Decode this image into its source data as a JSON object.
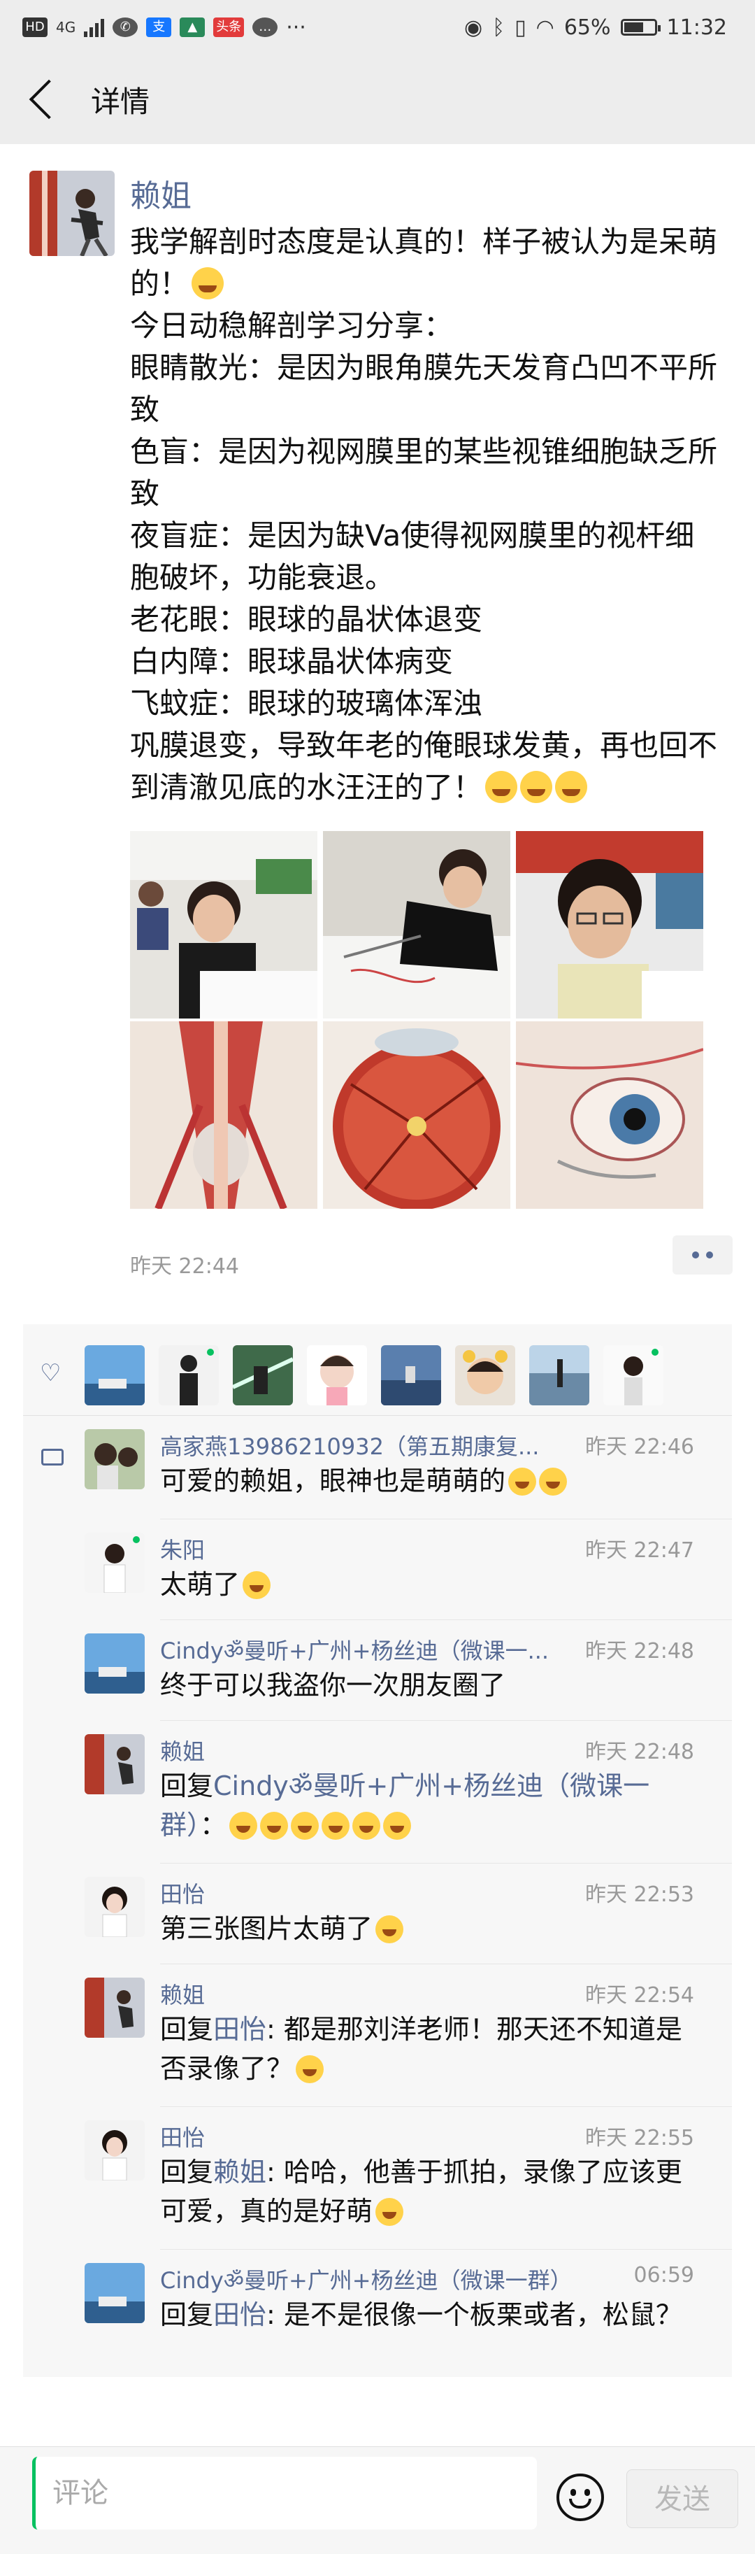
{
  "status_bar": {
    "network": "4G",
    "app_badge": "头条",
    "more": "···",
    "battery": "65%",
    "battery_level": 0.65,
    "time": "11:32"
  },
  "nav": {
    "title": "详情"
  },
  "post": {
    "author": "赖姐",
    "lines": [
      "我学解剖时态度是认真的！样子被认为是呆萌的！",
      "今日动稳解剖学习分享：",
      "眼睛散光：是因为眼角膜先天发育凸凹不平所致",
      "色盲：是因为视网膜里的某些视锥细胞缺乏所致",
      "夜盲症：是因为缺Va使得视网膜里的视杆细胞破坏，功能衰退。",
      "老花眼：眼球的晶状体退变",
      "白内障：眼球晶状体病变",
      "飞蚊症：眼球的玻璃体浑浊",
      "巩膜退变，导致年老的俺眼球发黄，再也回不到清澈见底的水汪汪的了！"
    ],
    "time": "昨天 22:44"
  },
  "comment_input": {
    "placeholder": "评论"
  },
  "send_label": "发送",
  "comments": [
    {
      "name": "高家燕13986210932（第五期康复...",
      "time": "昨天 22:46",
      "text": "可爱的赖姐，眼神也是萌萌的"
    },
    {
      "name": "朱阳",
      "time": "昨天 22:47",
      "text": "太萌了"
    },
    {
      "name": "Cindyॐ曼听+广州+杨丝迪（微课一...",
      "time": "昨天 22:48",
      "text": "终于可以我盗你一次朋友圈了"
    },
    {
      "name": "赖姐",
      "time": "昨天 22:48",
      "reply_prefix": "回复",
      "reply_to": "Cindyॐ曼听+广州+杨丝迪（微课一群）",
      "text": "："
    },
    {
      "name": "田怡",
      "time": "昨天 22:53",
      "text": "第三张图片太萌了"
    },
    {
      "name": "赖姐",
      "time": "昨天 22:54",
      "reply_prefix": "回复",
      "reply_to": "田怡",
      "text": ": 都是那刘洋老师！那天还不知道是否录像了？"
    },
    {
      "name": "田怡",
      "time": "昨天 22:55",
      "reply_prefix": "回复",
      "reply_to": "赖姐",
      "text": ": 哈哈，他善于抓拍，录像了应该更可爱，真的是好萌"
    },
    {
      "name": "Cindyॐ曼听+广州+杨丝迪（微课一群）",
      "time": "06:59",
      "reply_prefix": "回复",
      "reply_to": "田怡",
      "text": ": 是不是很像一个板栗或者，松鼠？"
    }
  ]
}
